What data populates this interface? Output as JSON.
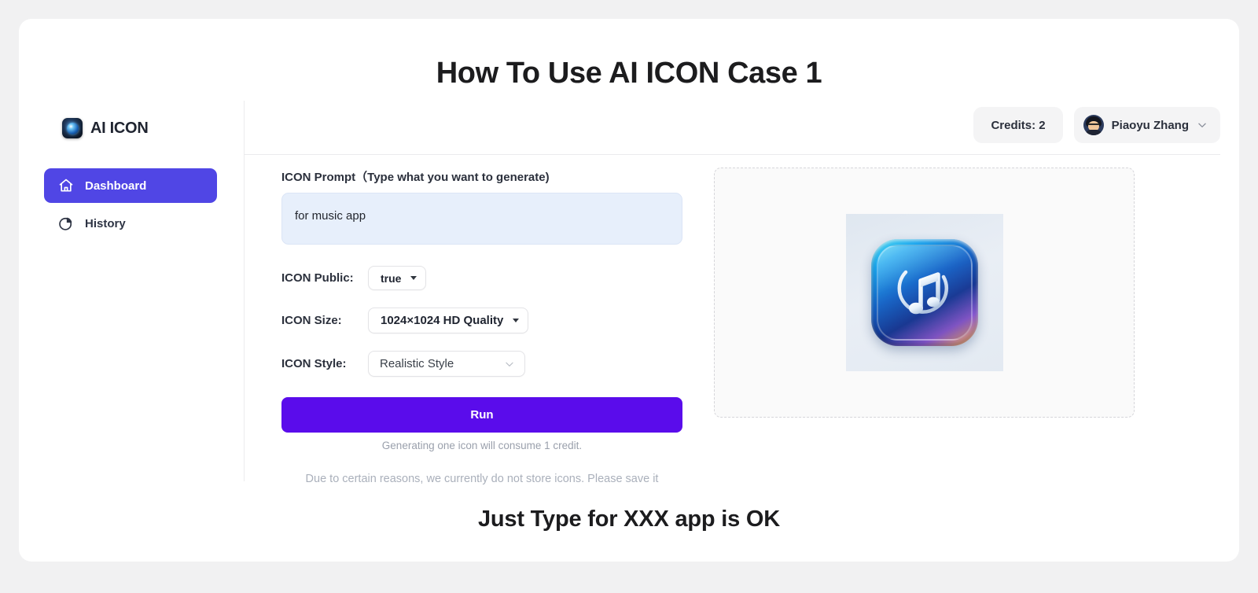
{
  "page": {
    "title": "How To Use AI ICON Case 1",
    "bottom_caption": "Just Type for XXX app is OK",
    "background_color": "#f1f1f2",
    "card_color": "#ffffff"
  },
  "sidebar": {
    "brand": {
      "name": "AI ICON",
      "logo_icon": "ai-icon-lens-logo"
    },
    "items": [
      {
        "label": "Dashboard",
        "icon": "home-icon",
        "active": true
      },
      {
        "label": "History",
        "icon": "pie-chart-icon",
        "active": false
      }
    ],
    "active_color": "#5046e5"
  },
  "topbar": {
    "credits_label": "Credits: 2",
    "user_name": "Piaoyu Zhang",
    "avatar_icon": "user-avatar",
    "chevron_icon": "chevron-down-icon"
  },
  "form": {
    "prompt_label": "ICON Prompt（Type what you want to generate)",
    "prompt_value": "for music app",
    "prompt_placeholder": "Type what you want to generate",
    "public_label": "ICON Public:",
    "public_value": "true",
    "public_options": [
      "true",
      "false"
    ],
    "size_label": "ICON Size:",
    "size_value": "1024×1024 HD Quality",
    "size_options": [
      "1024×1024 HD Quality"
    ],
    "style_label": "ICON Style:",
    "style_value": "Realistic Style",
    "style_options": [
      "Realistic Style"
    ],
    "run_label": "Run",
    "run_color": "#5a0ceb",
    "hint": "Generating one icon will consume 1 credit.",
    "notice": "Due to certain reasons, we currently do not store icons. Please save it"
  },
  "preview": {
    "generated_icon_name": "music-note-app-icon",
    "background_color": "#fafafa"
  }
}
